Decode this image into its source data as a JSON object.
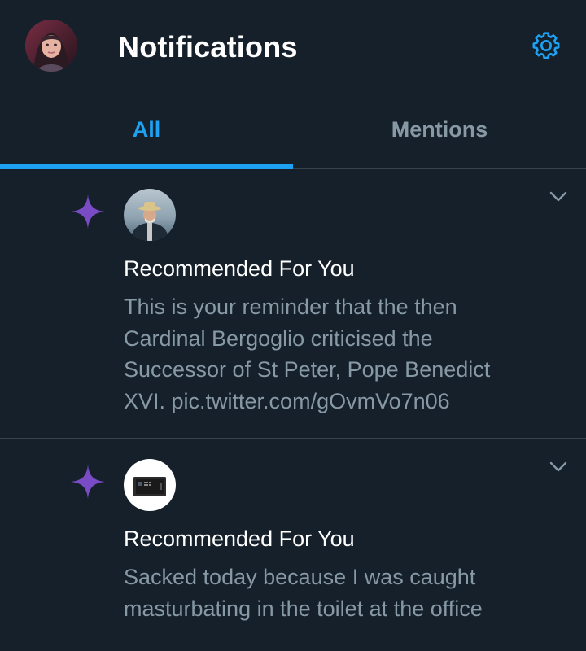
{
  "colors": {
    "background": "#15202b",
    "accent": "#1da1f2",
    "secondary_text": "#8899a6",
    "divider": "#38444d",
    "sparkle": "#794bc4"
  },
  "header": {
    "title": "Notifications",
    "settings_icon": "gear-icon",
    "profile_avatar_icon": "avatar"
  },
  "tabs": [
    {
      "label": "All",
      "active": true
    },
    {
      "label": "Mentions",
      "active": false
    }
  ],
  "notifications": [
    {
      "icon": "sparkle-icon",
      "heading": "Recommended For You",
      "body_lines": [
        "This is your reminder that the then",
        "Cardinal Bergoglio criticised the",
        "Successor of St Peter, Pope Benedict",
        "XVI. pic.twitter.com/gOvmVo7n06"
      ]
    },
    {
      "icon": "sparkle-icon",
      "heading": "Recommended For You",
      "body_lines": [
        "Sacked today because I was caught",
        "masturbating in the toilet at the office"
      ]
    }
  ]
}
